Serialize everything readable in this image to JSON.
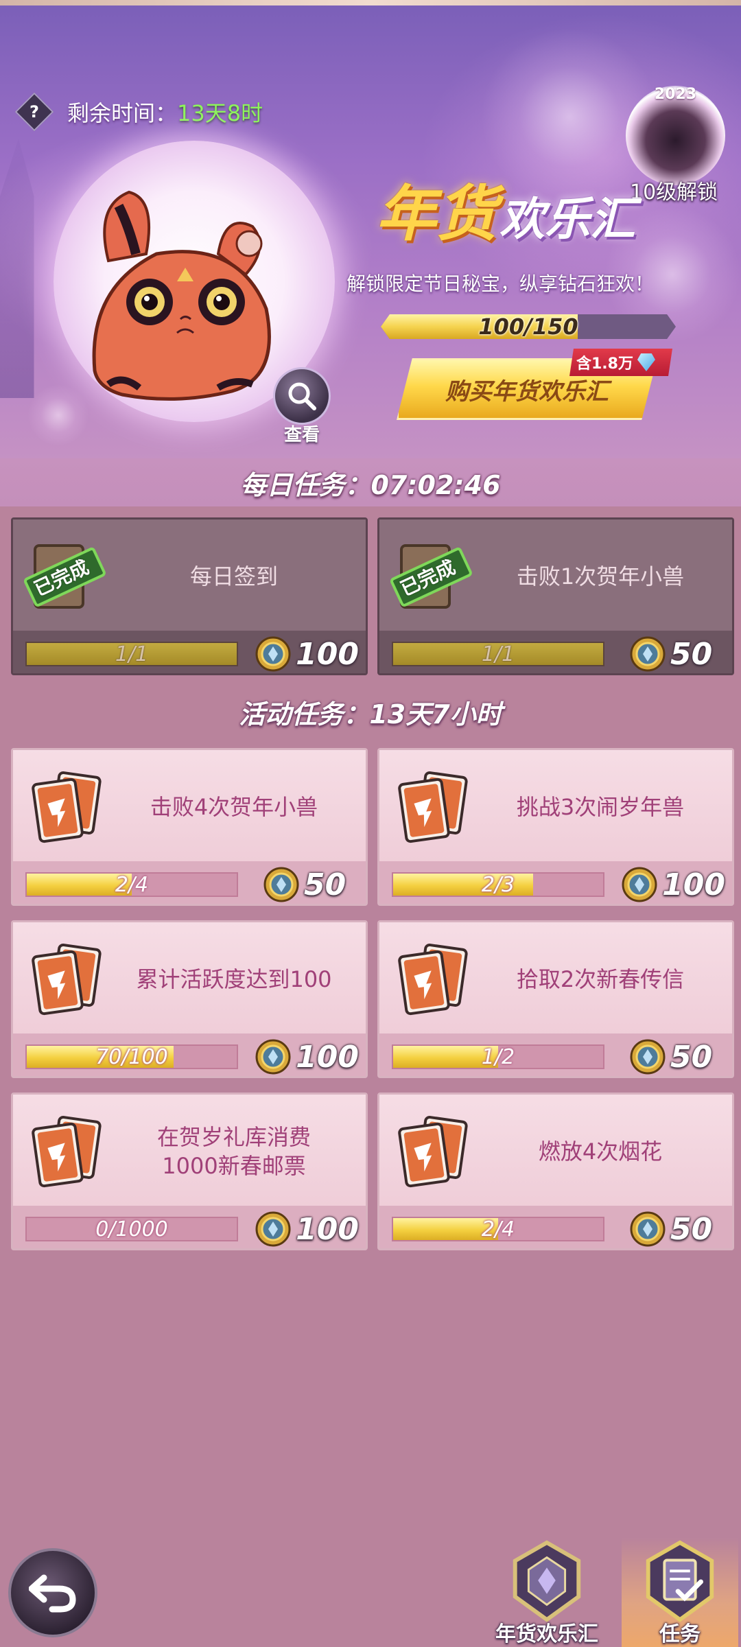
{
  "header": {
    "help_symbol": "?",
    "timer_label": "剩余时间：",
    "timer_value": "13天8时",
    "view_label": "查看",
    "badge_year": "2023",
    "unlock_label": "10级解锁"
  },
  "event": {
    "title_part1": "年货",
    "title_part2": "欢乐汇",
    "subtitle": "解锁限定节日秘宝，纵享钻石狂欢！",
    "progress_text": "100/150",
    "progress_current": 100,
    "progress_total": 150,
    "buy_button_label": "购买年货欢乐汇",
    "buy_tag": "含1.8万"
  },
  "daily": {
    "header": "每日任务：07:02:46",
    "completed_stamp": "已完成",
    "tasks": [
      {
        "title": "每日签到",
        "progress": "1/1",
        "fraction": 1.0,
        "reward": "100"
      },
      {
        "title": "击败1次贺年小兽",
        "progress": "1/1",
        "fraction": 1.0,
        "reward": "50"
      }
    ]
  },
  "activity": {
    "header": "活动任务：13天7小时",
    "tasks": [
      {
        "title": "击败4次贺年小兽",
        "progress": "2/4",
        "fraction": 0.5,
        "reward": "50"
      },
      {
        "title": "挑战3次闹岁年兽",
        "progress": "2/3",
        "fraction": 0.667,
        "reward": "100"
      },
      {
        "title": "累计活跃度达到100",
        "progress": "70/100",
        "fraction": 0.7,
        "reward": "100"
      },
      {
        "title": "拾取2次新春传信",
        "progress": "1/2",
        "fraction": 0.5,
        "reward": "50"
      },
      {
        "title": "在贺岁礼库消费\n1000新春邮票",
        "progress": "0/1000",
        "fraction": 0.0,
        "reward": "100"
      },
      {
        "title": "燃放4次烟花",
        "progress": "2/4",
        "fraction": 0.5,
        "reward": "50"
      }
    ]
  },
  "footer": {
    "tab_event_label": "年货欢乐汇",
    "tab_task_label": "任务",
    "active_tab": "任务"
  },
  "colors": {
    "timer_value": "#8df45a",
    "title_gold": "#ffd54a",
    "task_title": "#a04078",
    "progress_fill": "#f4d040",
    "buy_tag": "#e23a4a"
  }
}
